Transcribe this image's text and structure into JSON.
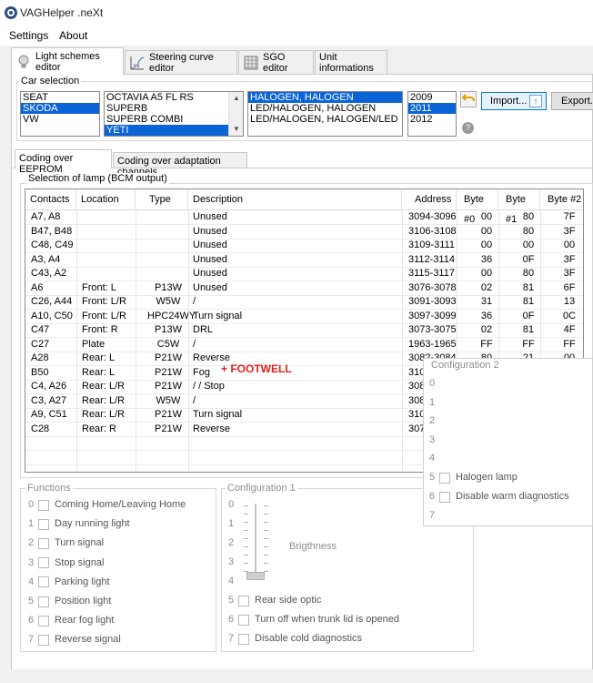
{
  "window": {
    "title": "VAGHelper .neXt"
  },
  "menu": {
    "settings": "Settings",
    "about": "About"
  },
  "main_tabs": [
    {
      "label": "Light schemes editor",
      "icon": "bulb-icon"
    },
    {
      "label": "Steering curve editor",
      "icon": "curve-chart-icon"
    },
    {
      "label": "SGO editor",
      "icon": "grid-icon"
    },
    {
      "label": "Unit informations"
    }
  ],
  "car_selection": {
    "label": "Car selection",
    "brands": [
      "SEAT",
      "SKODA",
      "VW"
    ],
    "brand_selected": "SKODA",
    "models": [
      "OCTAVIA A5 FL RS",
      "SUPERB",
      "SUPERB COMBI",
      "YETI"
    ],
    "model_selected": "YETI",
    "lights": [
      "HALOGEN, HALOGEN",
      "LED/HALOGEN, HALOGEN",
      "LED/HALOGEN, HALOGEN/LED"
    ],
    "light_selected": "HALOGEN, HALOGEN",
    "years": [
      "2009",
      "2011",
      "2012"
    ],
    "year_selected": "2011",
    "import_label": "Import...",
    "export_label": "Export..."
  },
  "sub_tabs": [
    "Coding over EEPROM",
    "Coding over adaptation channels"
  ],
  "lamp_selection": {
    "label": "Selection of lamp (BCM output)",
    "columns": [
      "Contacts",
      "Location",
      "Type",
      "Description",
      "Address",
      "Byte #0",
      "Byte #1",
      "Byte #2"
    ],
    "rows": [
      [
        "A7, A8",
        "",
        "",
        "Unused",
        "3094-3096",
        "00",
        "80",
        "7F"
      ],
      [
        "B47, B48",
        "",
        "",
        "Unused",
        "3106-3108",
        "00",
        "80",
        "3F"
      ],
      [
        "C48, C49",
        "",
        "",
        "Unused",
        "3109-3111",
        "00",
        "00",
        "00"
      ],
      [
        "A3, A4",
        "",
        "",
        "Unused",
        "3112-3114",
        "36",
        "0F",
        "3F"
      ],
      [
        "C43, A2",
        "",
        "",
        "Unused",
        "3115-3117",
        "00",
        "80",
        "3F"
      ],
      [
        "A6",
        "Front: L",
        "P13W",
        "Unused",
        "3076-3078",
        "02",
        "81",
        "6F"
      ],
      [
        "C26, A44",
        "Front: L/R",
        "W5W",
        "/",
        "3091-3093",
        "31",
        "81",
        "13"
      ],
      [
        "A10, C50",
        "Front: L/R",
        "HPC24WY",
        "Turn signal",
        "3097-3099",
        "36",
        "0F",
        "0C"
      ],
      [
        "C47",
        "Front: R",
        "P13W",
        "DRL",
        "3073-3075",
        "02",
        "81",
        "4F"
      ],
      [
        "C27",
        "Plate",
        "C5W",
        "/",
        "1963-1965",
        "FF",
        "FF",
        "FF"
      ],
      [
        "A28",
        "Rear: L",
        "P21W",
        "Reverse",
        "3082-3084",
        "80",
        "21",
        "00"
      ],
      [
        "B50",
        "Rear: L",
        "P21W",
        "Fog",
        "310",
        "",
        "",
        ""
      ],
      [
        "C4, A26",
        "Rear: L/R",
        "P21W",
        "/ / Stop",
        "308",
        "",
        "",
        ""
      ],
      [
        "C3, A27",
        "Rear: L/R",
        "W5W",
        "/",
        "308",
        "",
        "",
        ""
      ],
      [
        "A9, C51",
        "Rear: L/R",
        "P21W",
        "Turn signal",
        "310",
        "",
        "",
        ""
      ],
      [
        "C28",
        "Rear: R",
        "P21W",
        "Reverse",
        "307",
        "",
        "",
        ""
      ]
    ],
    "annotation": "+ FOOTWELL"
  },
  "functions": {
    "label": "Functions",
    "items": [
      {
        "index": "0",
        "label": "Coming Home/Leaving Home"
      },
      {
        "index": "1",
        "label": "Day running light"
      },
      {
        "index": "2",
        "label": "Turn signal"
      },
      {
        "index": "3",
        "label": "Stop signal"
      },
      {
        "index": "4",
        "label": "Parking light"
      },
      {
        "index": "5",
        "label": "Position light"
      },
      {
        "index": "6",
        "label": "Rear fog light"
      },
      {
        "index": "7",
        "label": "Reverse signal"
      }
    ]
  },
  "configuration1": {
    "label": "Configuration 1",
    "indices": [
      "0",
      "1",
      "2",
      "3",
      "4"
    ],
    "brightness_label": "Brigthness",
    "items": [
      {
        "index": "5",
        "label": "Rear side optic"
      },
      {
        "index": "6",
        "label": "Turn off when trunk lid is opened"
      },
      {
        "index": "7",
        "label": "Disable cold diagnostics"
      }
    ]
  },
  "configuration2": {
    "label": "Configuration 2",
    "indices": [
      "0",
      "1",
      "2",
      "3",
      "4"
    ],
    "items": [
      {
        "index": "5",
        "label": "Halogen lamp"
      },
      {
        "index": "6",
        "label": "Disable warm diagnostics"
      }
    ],
    "last_index": "7"
  },
  "colors": {
    "selection": "#0a64d8",
    "annotation": "#e0201a",
    "accent": "#0078d7"
  }
}
